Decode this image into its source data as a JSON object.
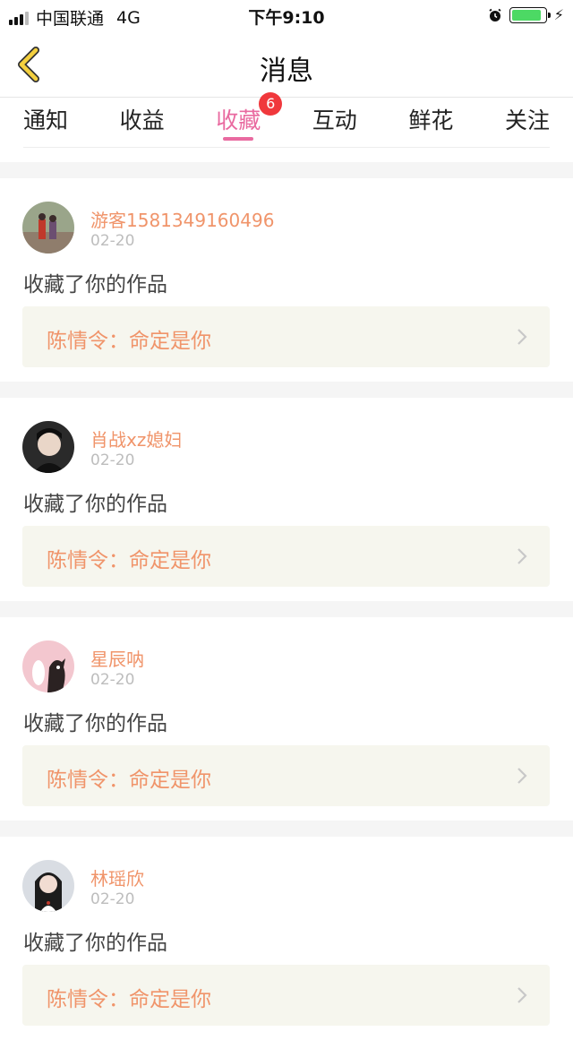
{
  "status_bar": {
    "carrier": "中国联通",
    "network": "4G",
    "time": "下午9:10",
    "battery_level": 0.95,
    "battery_color": "#4cd964"
  },
  "header": {
    "title": "消息",
    "back_icon": "chevron-left-icon",
    "back_color": "#f4d03f"
  },
  "tabs": [
    {
      "label": "通知"
    },
    {
      "label": "收益"
    },
    {
      "label": "收藏",
      "active": true,
      "badge": "6"
    },
    {
      "label": "互动"
    },
    {
      "label": "鲜花"
    },
    {
      "label": "关注"
    }
  ],
  "accent_color": "#e96aa0",
  "name_color": "#f0946a",
  "messages": [
    {
      "username": "游客1581349160496",
      "date": "02-20",
      "action": "收藏了你的作品",
      "work_title": "陈情令：命定是你"
    },
    {
      "username": "肖战xz媳妇",
      "date": "02-20",
      "action": "收藏了你的作品",
      "work_title": "陈情令：命定是你"
    },
    {
      "username": "星辰呐",
      "date": "02-20",
      "action": "收藏了你的作品",
      "work_title": "陈情令：命定是你"
    },
    {
      "username": "林瑶欣",
      "date": "02-20",
      "action": "收藏了你的作品",
      "work_title": "陈情令：命定是你"
    }
  ]
}
